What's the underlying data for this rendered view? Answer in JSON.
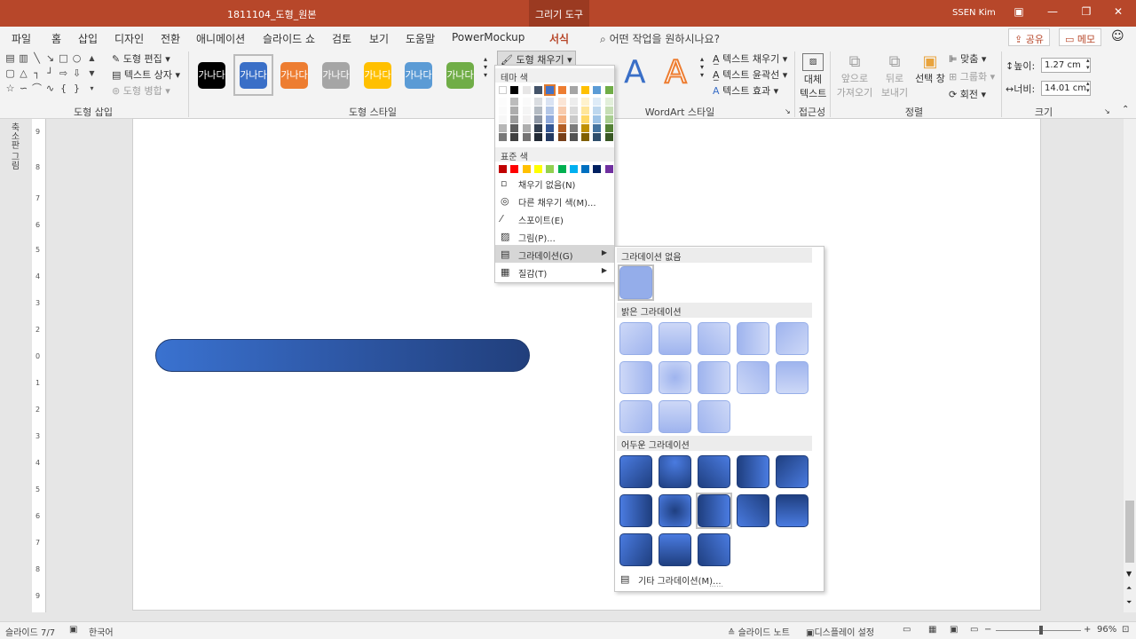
{
  "title_bar": {
    "filename": "1811104_도형_원본",
    "context_tab": "그리기 도구",
    "user": "SSEN Kim"
  },
  "tabs": [
    "파일",
    "홈",
    "삽입",
    "디자인",
    "전환",
    "애니메이션",
    "슬라이드 쇼",
    "검토",
    "보기",
    "도움말",
    "PowerMockup",
    "서식"
  ],
  "tell_me": "어떤 작업을 원하시나요?",
  "share": "공유",
  "memo": "메모",
  "ribbon": {
    "insert_shapes": {
      "edit_shape": "도형 편집",
      "text_box": "텍스트 상자",
      "merge_shapes": "도형 병합",
      "label": "도형 삽입"
    },
    "shape_styles": {
      "swatch_text": "가나다",
      "fill_button": "도형 채우기",
      "label": "도형 스타일",
      "swatches": [
        "#000000",
        "#3a6fc7",
        "#ed7d31",
        "#a5a5a5",
        "#ffc000",
        "#5b9bd5",
        "#70ad47"
      ]
    },
    "wordart": {
      "text_fill": "텍스트 채우기",
      "text_outline": "텍스트 윤곽선",
      "text_effects": "텍스트 효과",
      "label": "WordArt 스타일",
      "letter": "A"
    },
    "accessibility": {
      "alt_text_1": "대체",
      "alt_text_2": "텍스트",
      "label": "접근성"
    },
    "arrange": {
      "bring_forward_1": "앞으로",
      "bring_forward_2": "가져오기",
      "send_backward_1": "뒤로",
      "send_backward_2": "보내기",
      "selection_pane": "선택 창",
      "align": "맞춤",
      "group": "그룹화",
      "rotate": "회전",
      "label": "정렬"
    },
    "size": {
      "height_label": "높이:",
      "height": "1.27 cm",
      "width_label": "너비:",
      "width": "14.01 cm",
      "label": "크기"
    }
  },
  "fill_menu": {
    "theme_header": "테마 색",
    "theme_colors": [
      "#ffffff",
      "#000000",
      "#e7e6e6",
      "#44546a",
      "#4472c4",
      "#ed7d31",
      "#a5a5a5",
      "#ffc000",
      "#5b9bd5",
      "#70ad47"
    ],
    "standard_header": "표준 색",
    "standard_colors": [
      "#c00000",
      "#ff0000",
      "#ffc000",
      "#ffff00",
      "#92d050",
      "#00b050",
      "#00b0f0",
      "#0070c0",
      "#002060",
      "#7030a0"
    ],
    "items": [
      {
        "label": "채우기 없음(N)",
        "icon": "no-fill-icon"
      },
      {
        "label": "다른 채우기 색(M)...",
        "icon": "palette-icon"
      },
      {
        "label": "스포이트(E)",
        "icon": "eyedropper-icon"
      },
      {
        "label": "그림(P)...",
        "icon": "picture-icon"
      },
      {
        "label": "그라데이션(G)",
        "icon": "gradient-icon"
      },
      {
        "label": "질감(T)",
        "icon": "texture-icon"
      }
    ]
  },
  "gradient_panel": {
    "no_gradient": "그라데이션 없음",
    "light": "밝은 그라데이션",
    "dark": "어두운 그라데이션",
    "more": "기타 그라데이션(M)..."
  },
  "left_panel": "축소판 그림",
  "status": {
    "slide": "슬라이드 7/7",
    "language": "한국어",
    "notes": "슬라이드 노트",
    "display": "디스플레이 설정",
    "zoom": "96%"
  }
}
